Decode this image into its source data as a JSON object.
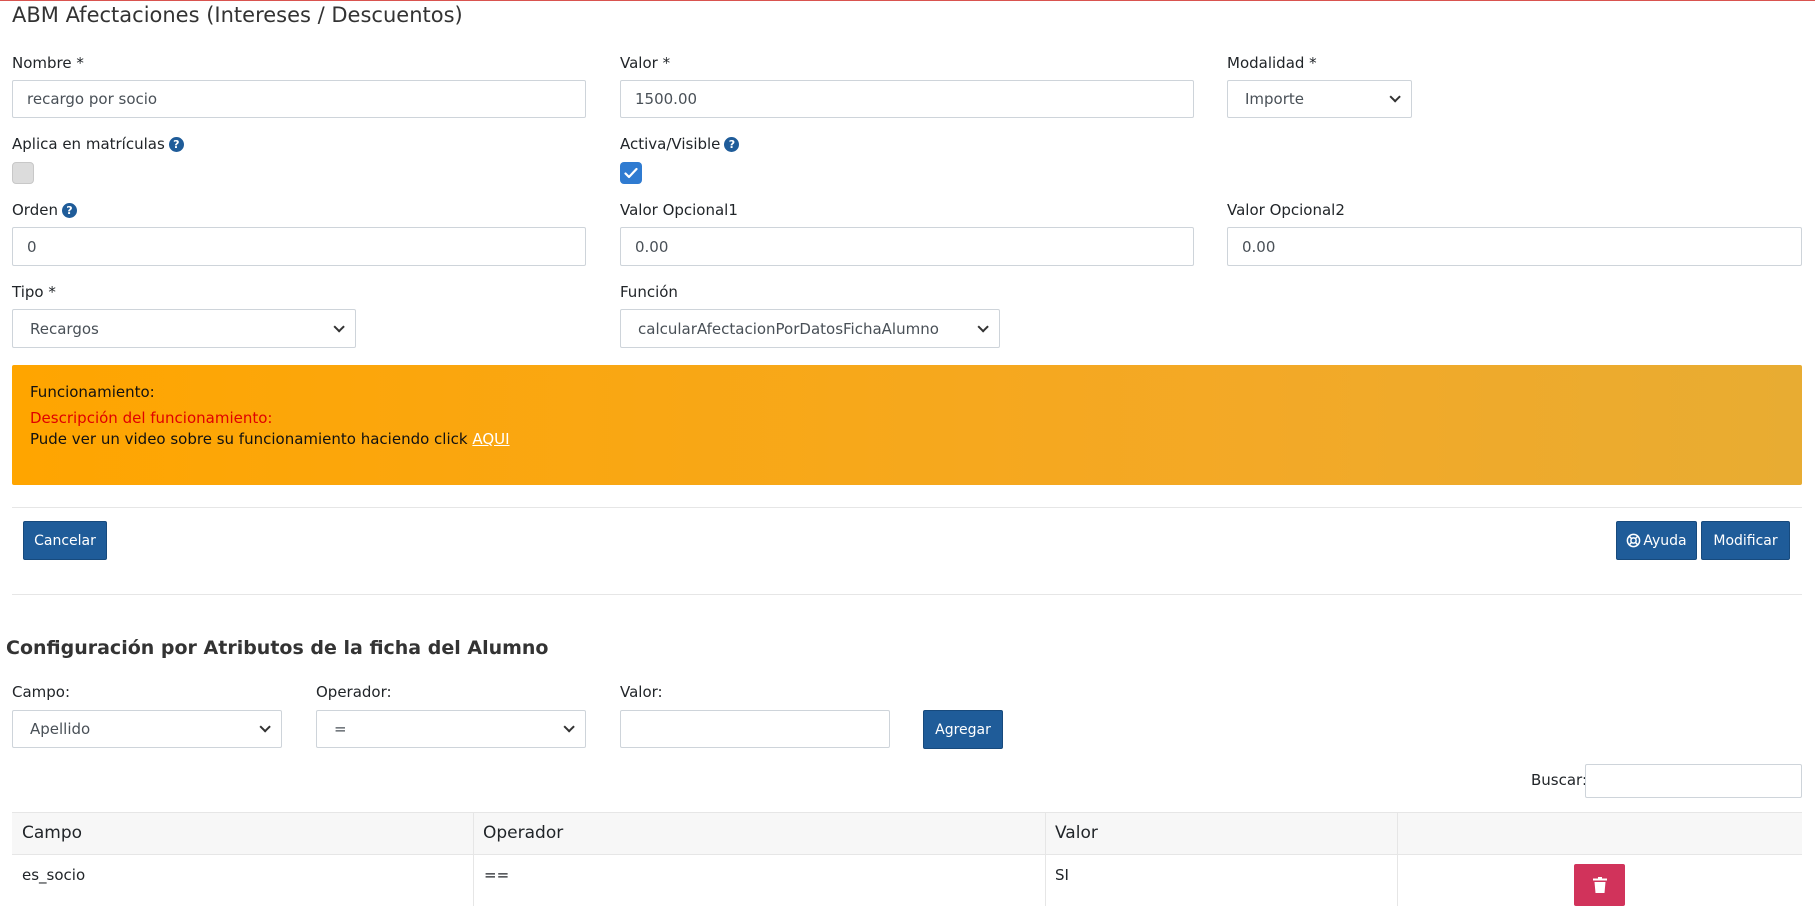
{
  "page": {
    "title": "ABM Afectaciones (Intereses / Descuentos)"
  },
  "form": {
    "nombre": {
      "label": "Nombre *",
      "value": "recargo por socio"
    },
    "valor": {
      "label": "Valor *",
      "value": "1500.00"
    },
    "modalidad": {
      "label": "Modalidad *",
      "value": "Importe"
    },
    "aplica_matriculas": {
      "label": "Aplica en matrículas",
      "checked": false
    },
    "activa_visible": {
      "label": "Activa/Visible",
      "checked": true
    },
    "orden": {
      "label": "Orden",
      "value": "0"
    },
    "valor_opcional1": {
      "label": "Valor Opcional1",
      "value": "0.00"
    },
    "valor_opcional2": {
      "label": "Valor Opcional2",
      "value": "0.00"
    },
    "tipo": {
      "label": "Tipo *",
      "value": "Recargos"
    },
    "funcion": {
      "label": "Función",
      "value": "calcularAfectacionPorDatosFichaAlumno"
    },
    "help_glyph": "?"
  },
  "alert": {
    "heading": "Funcionamiento:",
    "description": "Descripción del funcionamiento:",
    "text": "Pude ver un video sobre su funcionamiento haciendo click ",
    "link": "AQUI"
  },
  "actions": {
    "cancel": "Cancelar",
    "help": "Ayuda",
    "modify": "Modificar"
  },
  "config": {
    "title": "Configuración por Atributos de la ficha del Alumno",
    "campo": {
      "label": "Campo:",
      "value": "Apellido"
    },
    "operador": {
      "label": "Operador:",
      "value": "="
    },
    "valor": {
      "label": "Valor:",
      "value": ""
    },
    "add": "Agregar",
    "search_label": "Buscar:",
    "search_value": ""
  },
  "table": {
    "headers": [
      "Campo",
      "Operador",
      "Valor",
      ""
    ],
    "rows": [
      {
        "campo": "es_socio",
        "operador": "==",
        "valor": "SI"
      }
    ]
  },
  "colors": {
    "primary": "#1f5c99",
    "alert": "#ffa500",
    "danger": "#d1335b",
    "checkbox": "#2f7bd1",
    "description_red": "#e00000"
  }
}
